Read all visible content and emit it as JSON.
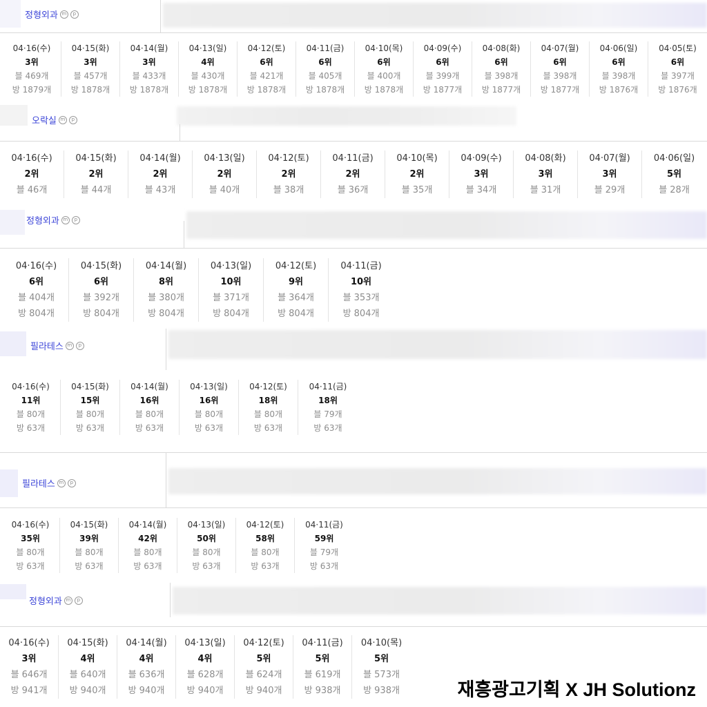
{
  "sections": [
    {
      "title": "정형외과",
      "badges": [
        "m",
        "p"
      ],
      "cols": [
        {
          "date": "04·16(수)",
          "rank": "3위",
          "blog": "블 469개",
          "place": "방 1879개"
        },
        {
          "date": "04·15(화)",
          "rank": "3위",
          "blog": "블 457개",
          "place": "방 1878개"
        },
        {
          "date": "04·14(월)",
          "rank": "3위",
          "blog": "블 433개",
          "place": "방 1878개"
        },
        {
          "date": "04·13(일)",
          "rank": "4위",
          "blog": "블 430개",
          "place": "방 1878개"
        },
        {
          "date": "04·12(토)",
          "rank": "6위",
          "blog": "블 421개",
          "place": "방 1878개"
        },
        {
          "date": "04·11(금)",
          "rank": "6위",
          "blog": "블 405개",
          "place": "방 1878개"
        },
        {
          "date": "04·10(목)",
          "rank": "6위",
          "blog": "블 400개",
          "place": "방 1878개"
        },
        {
          "date": "04·09(수)",
          "rank": "6위",
          "blog": "블 399개",
          "place": "방 1877개"
        },
        {
          "date": "04·08(화)",
          "rank": "6위",
          "blog": "블 398개",
          "place": "방 1877개"
        },
        {
          "date": "04·07(월)",
          "rank": "6위",
          "blog": "블 398개",
          "place": "방 1877개"
        },
        {
          "date": "04·06(일)",
          "rank": "6위",
          "blog": "블 398개",
          "place": "방 1876개"
        },
        {
          "date": "04·05(토)",
          "rank": "6위",
          "blog": "블 397개",
          "place": "방 1876개"
        }
      ]
    },
    {
      "title": "오락실",
      "badges": [
        "m",
        "p"
      ],
      "cols": [
        {
          "date": "04·16(수)",
          "rank": "2위",
          "blog": "블 46개"
        },
        {
          "date": "04·15(화)",
          "rank": "2위",
          "blog": "블 44개"
        },
        {
          "date": "04·14(월)",
          "rank": "2위",
          "blog": "블 43개"
        },
        {
          "date": "04·13(일)",
          "rank": "2위",
          "blog": "블 40개"
        },
        {
          "date": "04·12(토)",
          "rank": "2위",
          "blog": "블 38개"
        },
        {
          "date": "04·11(금)",
          "rank": "2위",
          "blog": "블 36개"
        },
        {
          "date": "04·10(목)",
          "rank": "2위",
          "blog": "블 35개"
        },
        {
          "date": "04·09(수)",
          "rank": "3위",
          "blog": "블 34개"
        },
        {
          "date": "04·08(화)",
          "rank": "3위",
          "blog": "블 31개"
        },
        {
          "date": "04·07(월)",
          "rank": "3위",
          "blog": "블 29개"
        },
        {
          "date": "04·06(일)",
          "rank": "5위",
          "blog": "블 28개"
        }
      ]
    },
    {
      "title": "정형외과",
      "badges": [
        "m",
        "p"
      ],
      "cols": [
        {
          "date": "04·16(수)",
          "rank": "6위",
          "blog": "블 404개",
          "place": "방 804개"
        },
        {
          "date": "04·15(화)",
          "rank": "6위",
          "blog": "블 392개",
          "place": "방 804개"
        },
        {
          "date": "04·14(월)",
          "rank": "8위",
          "blog": "블 380개",
          "place": "방 804개"
        },
        {
          "date": "04·13(일)",
          "rank": "10위",
          "blog": "블 371개",
          "place": "방 804개"
        },
        {
          "date": "04·12(토)",
          "rank": "9위",
          "blog": "블 364개",
          "place": "방 804개"
        },
        {
          "date": "04·11(금)",
          "rank": "10위",
          "blog": "블 353개",
          "place": "방 804개"
        }
      ]
    },
    {
      "title": "필라테스",
      "badges": [
        "m",
        "p"
      ],
      "cols": [
        {
          "date": "04·16(수)",
          "rank": "11위",
          "blog": "블 80개",
          "place": "방 63개"
        },
        {
          "date": "04·15(화)",
          "rank": "15위",
          "blog": "블 80개",
          "place": "방 63개"
        },
        {
          "date": "04·14(월)",
          "rank": "16위",
          "blog": "블 80개",
          "place": "방 63개"
        },
        {
          "date": "04·13(일)",
          "rank": "16위",
          "blog": "블 80개",
          "place": "방 63개"
        },
        {
          "date": "04·12(토)",
          "rank": "18위",
          "blog": "블 80개",
          "place": "방 63개"
        },
        {
          "date": "04·11(금)",
          "rank": "18위",
          "blog": "블 79개",
          "place": "방 63개"
        }
      ]
    },
    {
      "title": "필라테스",
      "badges": [
        "m",
        "p"
      ],
      "cols": [
        {
          "date": "04·16(수)",
          "rank": "35위",
          "blog": "블 80개",
          "place": "방 63개"
        },
        {
          "date": "04·15(화)",
          "rank": "39위",
          "blog": "블 80개",
          "place": "방 63개"
        },
        {
          "date": "04·14(월)",
          "rank": "42위",
          "blog": "블 80개",
          "place": "방 63개"
        },
        {
          "date": "04·13(일)",
          "rank": "50위",
          "blog": "블 80개",
          "place": "방 63개"
        },
        {
          "date": "04·12(토)",
          "rank": "58위",
          "blog": "블 80개",
          "place": "방 63개"
        },
        {
          "date": "04·11(금)",
          "rank": "59위",
          "blog": "블 79개",
          "place": "방 63개"
        }
      ]
    },
    {
      "title": "정형외과",
      "badges": [
        "m",
        "p"
      ],
      "cols": [
        {
          "date": "04·16(수)",
          "rank": "3위",
          "blog": "블 646개",
          "place": "방 941개"
        },
        {
          "date": "04·15(화)",
          "rank": "4위",
          "blog": "블 640개",
          "place": "방 940개"
        },
        {
          "date": "04·14(월)",
          "rank": "4위",
          "blog": "블 636개",
          "place": "방 940개"
        },
        {
          "date": "04·13(일)",
          "rank": "4위",
          "blog": "블 628개",
          "place": "방 940개"
        },
        {
          "date": "04·12(토)",
          "rank": "5위",
          "blog": "블 624개",
          "place": "방 940개"
        },
        {
          "date": "04·11(금)",
          "rank": "5위",
          "blog": "블 619개",
          "place": "방 938개"
        },
        {
          "date": "04·10(목)",
          "rank": "5위",
          "blog": "블 573개",
          "place": "방 938개"
        }
      ]
    }
  ],
  "footer": {
    "text": "재흥광고기획 X JH Solutionz"
  }
}
